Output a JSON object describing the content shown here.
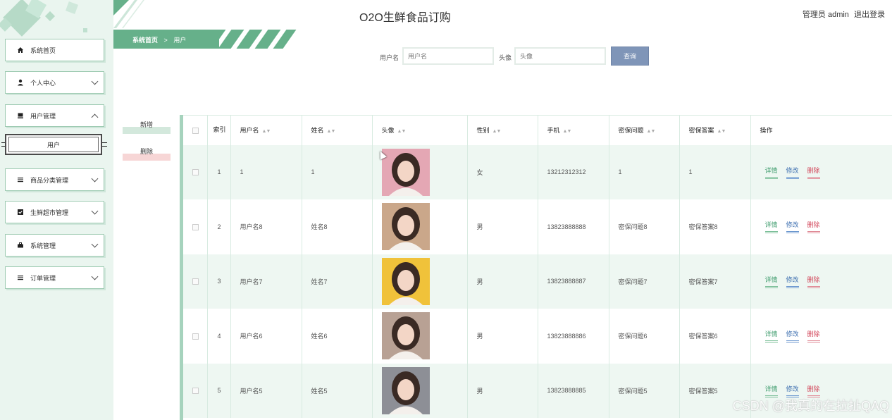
{
  "header": {
    "title": "O2O生鲜食品订购",
    "user_prefix": "管理员 admin",
    "logout": "退出登录"
  },
  "breadcrumb": {
    "home": "系统首页",
    "sep": ">",
    "current": "用户"
  },
  "sidebar": {
    "items": [
      {
        "label": "系统首页",
        "icon": "home-icon"
      },
      {
        "label": "个人中心",
        "icon": "user-icon"
      },
      {
        "label": "用户管理",
        "icon": "user-manage-icon"
      },
      {
        "label": "商品分类管理",
        "icon": "list-icon"
      },
      {
        "label": "生鲜超市管理",
        "icon": "check-icon"
      },
      {
        "label": "系统管理",
        "icon": "briefcase-icon"
      },
      {
        "label": "订单管理",
        "icon": "list-icon"
      }
    ],
    "sub_item": "用户"
  },
  "search": {
    "username_label": "用户名",
    "username_placeholder": "用户名",
    "avatar_label": "头像",
    "avatar_placeholder": "头像",
    "button": "查询"
  },
  "actions": {
    "add": "新增",
    "delete": "删除"
  },
  "table": {
    "headers": [
      "索引",
      "用户名",
      "姓名",
      "头像",
      "性别",
      "手机",
      "密保问题",
      "密保答案",
      "操作"
    ],
    "ops": {
      "detail": "详情",
      "edit": "修改",
      "delete": "删除"
    },
    "rows": [
      {
        "index": "1",
        "username": "1",
        "name": "1",
        "gender": "女",
        "phone": "13212312312",
        "question": "1",
        "answer": "1",
        "avatar_color": "#e4a7b4"
      },
      {
        "index": "2",
        "username": "用户名8",
        "name": "姓名8",
        "gender": "男",
        "phone": "13823888888",
        "question": "密保问题8",
        "answer": "密保答案8",
        "avatar_color": "#caa78a"
      },
      {
        "index": "3",
        "username": "用户名7",
        "name": "姓名7",
        "gender": "男",
        "phone": "13823888887",
        "question": "密保问题7",
        "answer": "密保答案7",
        "avatar_color": "#f0c23a"
      },
      {
        "index": "4",
        "username": "用户名6",
        "name": "姓名6",
        "gender": "男",
        "phone": "13823888886",
        "question": "密保问题6",
        "answer": "密保答案6",
        "avatar_color": "#b8a194"
      },
      {
        "index": "5",
        "username": "用户名5",
        "name": "姓名5",
        "gender": "男",
        "phone": "13823888885",
        "question": "密保问题5",
        "answer": "密保答案5",
        "avatar_color": "#8d8f96"
      }
    ]
  },
  "watermark": "CSDN @我真的在拉扯QAQ"
}
